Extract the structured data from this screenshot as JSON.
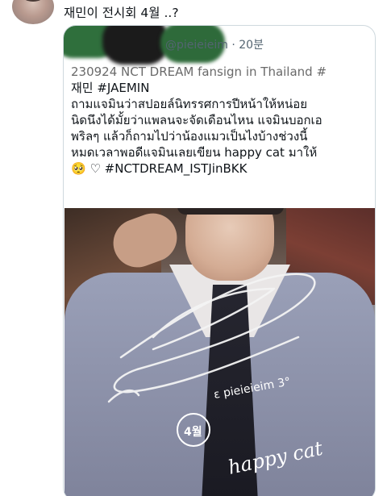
{
  "post": {
    "text": "재민이 전시회 4월 ..?"
  },
  "quote": {
    "handle_time": "@pieieieim · 20분",
    "top_line": "230924 NCT DREAM fansign in Thailand #",
    "body_rest": "재민 #JAEMIN\nถามแจมินว่าสปอยล์นิทรรศการปีหน้าให้หน่อย\nนิดนึงได้มั้ยว่าแพลนจะจัดเดือนไหน แจมินบอกเอ\nพริลๆ แล้วก็ถามไปว่าน้องแมวเป็นไงบ้างช่วงนี้\nหมดเวลาพอดีแจมินเลยเขียน happy cat มาให้\n🥺 ♡ #NCTDREAM_ISTJinBKK"
  },
  "photo": {
    "signature_handle": "ε pieieieim 3°",
    "signature_date": "4월",
    "signature_message": "happy cat"
  }
}
